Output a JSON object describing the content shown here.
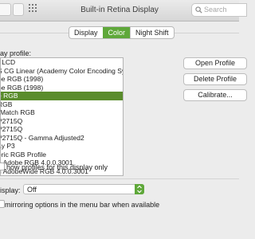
{
  "window": {
    "title": "Built-in Retina Display"
  },
  "search": {
    "placeholder": "Search"
  },
  "tabs": [
    {
      "label": "Display",
      "active": false
    },
    {
      "label": "Color",
      "active": true
    },
    {
      "label": "Night Shift",
      "active": false
    }
  ],
  "profile_section": {
    "label": "ay profile:"
  },
  "profiles": [
    {
      "label": "r LCD",
      "selected": false
    },
    {
      "label": "S CG Linear (Academy Color Encoding Sy...",
      "selected": false
    },
    {
      "label": "be RGB (1998)",
      "selected": false
    },
    {
      "label": "be RGB (1998)",
      "selected": false
    },
    {
      "label": "e RGB",
      "selected": true
    },
    {
      "label": "RGB",
      "selected": false
    },
    {
      "label": "rMatch RGB",
      "selected": false
    },
    {
      "label": "P2715Q",
      "selected": false
    },
    {
      "label": "P2715Q",
      "selected": false
    },
    {
      "label": "P2715Q - Gamma Adjusted2",
      "selected": false
    },
    {
      "label": "ay P3",
      "selected": false
    },
    {
      "label": "eric RGB Profile",
      "selected": false
    },
    {
      "label": "n Adobe RGB 4.0.0.3001",
      "selected": false
    },
    {
      "label": "n AdobeWide RGB 4.0.0.3001",
      "selected": false
    }
  ],
  "buttons": {
    "open_profile": "Open Profile",
    "delete_profile": "Delete Profile",
    "calibrate": "Calibrate..."
  },
  "show_profiles": {
    "label": "how profiles for this display only"
  },
  "airplay": {
    "label": "isplay:",
    "value": "Off"
  },
  "mirroring": {
    "label": "mirroring options in the menu bar when available"
  },
  "colors": {
    "accent": "#5fa83a",
    "selection": "#5a8c2c"
  }
}
